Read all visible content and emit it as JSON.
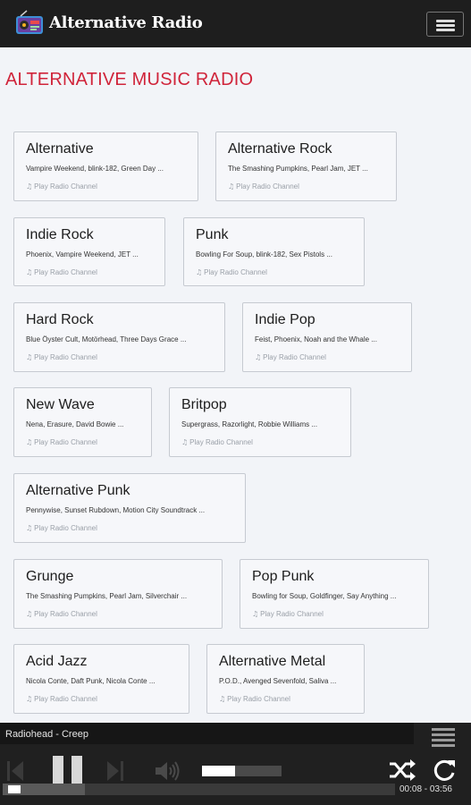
{
  "header": {
    "app_title": "Alternative Radio",
    "logo_icon": "radio-logo-icon",
    "menu_icon": "hamburger-menu-icon"
  },
  "page": {
    "heading": "ALTERNATIVE MUSIC RADIO"
  },
  "stations": [
    {
      "name": "Alternative",
      "artists": "Vampire Weekend, blink-182, Green Day ...",
      "play_label": "Play Radio Channel"
    },
    {
      "name": "Alternative Rock",
      "artists": "The Smashing Pumpkins, Pearl Jam, JET ...",
      "play_label": "Play Radio Channel"
    },
    {
      "name": "Indie Rock",
      "artists": "Phoenix, Vampire Weekend, JET ...",
      "play_label": "Play Radio Channel"
    },
    {
      "name": "Punk",
      "artists": "Bowling For Soup, blink-182, Sex Pistols ...",
      "play_label": "Play Radio Channel"
    },
    {
      "name": "Hard Rock",
      "artists": "Blue Öyster Cult, Motörhead, Three Days Grace ...",
      "play_label": "Play Radio Channel"
    },
    {
      "name": "Indie Pop",
      "artists": "Feist, Phoenix, Noah and the Whale ...",
      "play_label": "Play Radio Channel"
    },
    {
      "name": "New Wave",
      "artists": "Nena, Erasure, David Bowie ...",
      "play_label": "Play Radio Channel"
    },
    {
      "name": "Britpop",
      "artists": "Supergrass, Razorlight, Robbie Williams ...",
      "play_label": "Play Radio Channel"
    },
    {
      "name": "Alternative Punk",
      "artists": "Pennywise, Sunset Rubdown, Motion City Soundtrack ...",
      "play_label": "Play Radio Channel"
    },
    {
      "name": "Grunge",
      "artists": "The Smashing Pumpkins, Pearl Jam, Silverchair ...",
      "play_label": "Play Radio Channel"
    },
    {
      "name": "Pop Punk",
      "artists": "Bowling for Soup, Goldfinger, Say Anything ...",
      "play_label": "Play Radio Channel"
    },
    {
      "name": "Acid Jazz",
      "artists": "Nicola Conte, Daft Punk, Nicola Conte ...",
      "play_label": "Play Radio Channel"
    },
    {
      "name": "Alternative Metal",
      "artists": "P.O.D., Avenged Sevenfold, Saliva ...",
      "play_label": "Play Radio Channel"
    }
  ],
  "player": {
    "now_playing": "Radiohead - Creep",
    "time": "00:08 - 03:56",
    "volume_level": 0.42,
    "progress_fraction": 0.034,
    "buffer_fraction": 0.21,
    "icons": [
      "skip-previous-icon",
      "pause-icon",
      "skip-next-icon",
      "volume-icon",
      "shuffle-icon",
      "repeat-icon",
      "playlist-icon"
    ]
  },
  "colors": {
    "accent": "#d0243a",
    "header_bg": "#1e1e1e",
    "page_bg": "#f2f4f8",
    "player_bg": "#202020"
  }
}
